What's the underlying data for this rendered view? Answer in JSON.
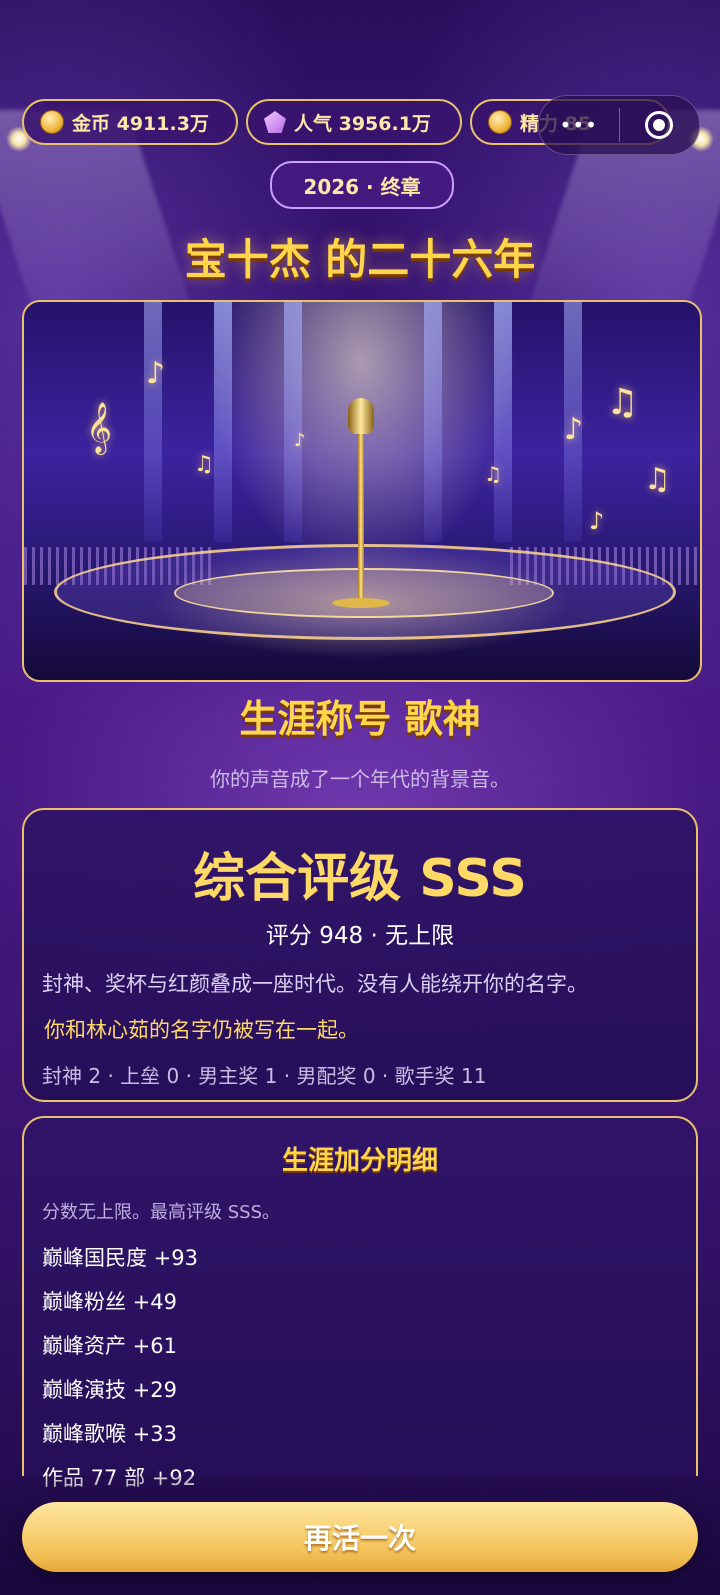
{
  "stats": [
    {
      "icon": "coin-icon",
      "label": "金币 4911.3万"
    },
    {
      "icon": "gem-icon",
      "label": "人气 3956.1万"
    },
    {
      "icon": "coin-icon",
      "label": "精力 85"
    }
  ],
  "capsule": {
    "more": "•••",
    "close_icon": "target-icon"
  },
  "year_pill": "2026 · 终章",
  "title": "宝十杰 的二十六年",
  "career_title": "生涯称号 歌神",
  "tagline": "你的声音成了一个年代的背景音。",
  "summary": {
    "rating": "综合评级 SSS",
    "score": "评分 948 · 无上限",
    "description": "封神、奖杯与红颜叠成一座时代。没有人能绕开你的名字。",
    "partner_line": "你和林心茹的名字仍被写在一起。",
    "awards": "封神 2 · 上垒 0 · 男主奖 1 · 男配奖 0 · 歌手奖 11"
  },
  "details": {
    "title": "生涯加分明细",
    "note": "分数无上限。最高评级 SSS。",
    "items": [
      "巅峰国民度 +93",
      "巅峰粉丝 +49",
      "巅峰资产 +61",
      "巅峰演技 +29",
      "巅峰歌喉 +33",
      "作品 77 部 +92"
    ]
  },
  "retry_label": "再活一次",
  "colors": {
    "gold": "#ffd54a",
    "purple": "#3a1578",
    "border": "#e8c26a"
  }
}
